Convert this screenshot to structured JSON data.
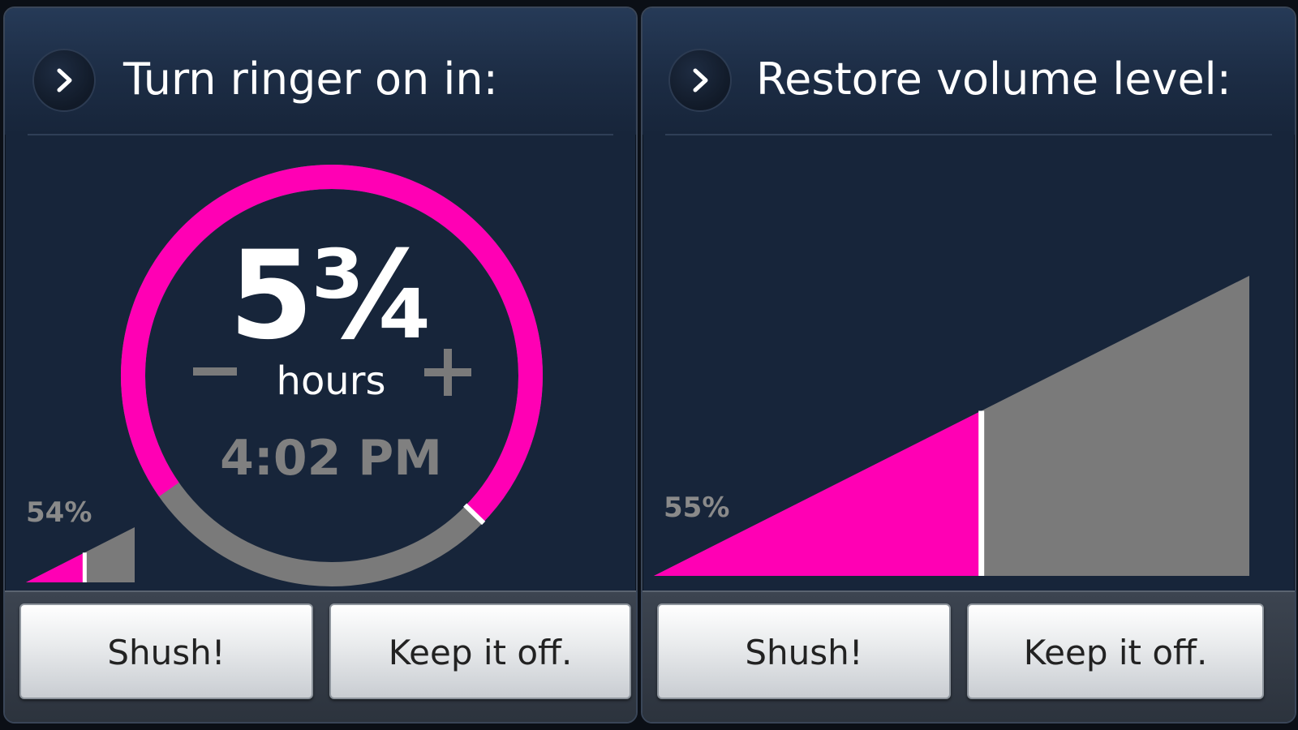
{
  "left_panel": {
    "title": "Turn ringer on in:",
    "duration_value": "5¾",
    "duration_unit": "hours",
    "end_time": "4:02 PM",
    "duration_fill_fraction": 0.72,
    "volume_percent": "54%",
    "volume_fraction": 0.54,
    "buttons": {
      "shush": "Shush!",
      "keep_off": "Keep it off."
    }
  },
  "right_panel": {
    "title": "Restore volume level:",
    "volume_percent": "55%",
    "volume_fraction": 0.55,
    "buttons": {
      "shush": "Shush!",
      "keep_off": "Keep it off."
    }
  },
  "colors": {
    "accent": "#ff00b4",
    "inactive": "#7a7a7a",
    "panel_bg": "#17253a"
  },
  "icons": {
    "expand": "chevron-right-icon",
    "decrease": "minus-icon",
    "increase": "plus-icon"
  }
}
